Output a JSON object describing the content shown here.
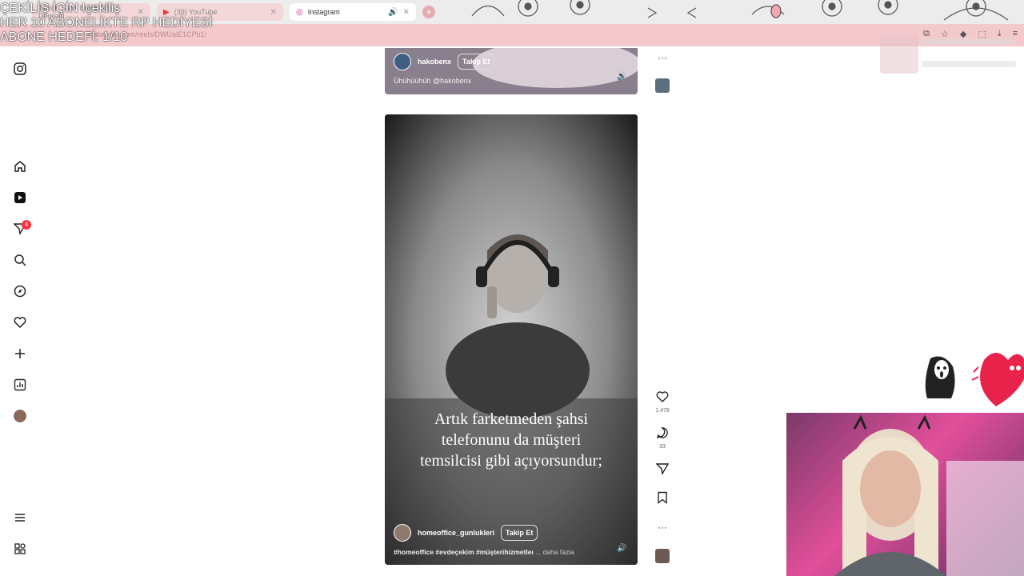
{
  "browser": {
    "tabs": [
      {
        "label": "Twitch Sabri Boyle Bir Degistiri",
        "active": false
      },
      {
        "label": "(39) YouTube",
        "active": false
      },
      {
        "label": "Instagram",
        "active": true
      }
    ],
    "url": "instagram.com/reels/DWUalE1CPb1/"
  },
  "stream_overlay": {
    "line1": "ÇEKİLİŞ İÇİN !çekiliş",
    "line2": "HER 10 ABONELİKTE RP HEDİYESİ",
    "line3": "ABONE HEDEFİ: 1/10"
  },
  "sidebar": {
    "notification_count": "4"
  },
  "top_reel": {
    "username": "hakobenx",
    "follow_label": "Takip Et",
    "description": "Ühühüühüh @hakobenx"
  },
  "main_reel": {
    "caption_lines": [
      "Artık farketmeden şahsi",
      "telefonunu da müşteri",
      "temsilcisi gibi açıyorsundur;"
    ],
    "username": "homeoffice_gunlukleri",
    "follow_label": "Takip Et",
    "hashtags": "#homeoffice #evdeçekim #müşterihizmetleı",
    "more_label": "... daha fazla",
    "like_count": "1.478",
    "comment_count": "33"
  },
  "colors": {
    "tabbar_bg": "#ececec",
    "urlbar_bg": "#f3c9cc",
    "notification_badge": "#ff3040"
  }
}
